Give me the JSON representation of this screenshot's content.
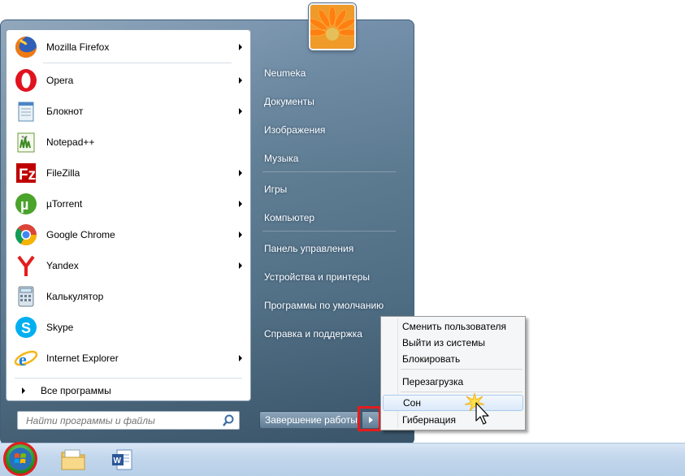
{
  "start_menu": {
    "programs": [
      {
        "label": "Mozilla Firefox",
        "icon": "firefox-icon",
        "has_submenu": true
      },
      {
        "label": "Opera",
        "icon": "opera-icon",
        "has_submenu": true
      },
      {
        "label": "Блокнот",
        "icon": "notepad-icon",
        "has_submenu": true
      },
      {
        "label": "Notepad++",
        "icon": "notepad-plus-plus-icon",
        "has_submenu": false
      },
      {
        "label": "FileZilla",
        "icon": "filezilla-icon",
        "has_submenu": true
      },
      {
        "label": "µTorrent",
        "icon": "utorrent-icon",
        "has_submenu": true
      },
      {
        "label": "Google Chrome",
        "icon": "chrome-icon",
        "has_submenu": true
      },
      {
        "label": "Yandex",
        "icon": "yandex-icon",
        "has_submenu": true
      },
      {
        "label": "Калькулятор",
        "icon": "calculator-icon",
        "has_submenu": false
      },
      {
        "label": "Skype",
        "icon": "skype-icon",
        "has_submenu": false
      },
      {
        "label": "Internet Explorer",
        "icon": "internet-explorer-icon",
        "has_submenu": true
      }
    ],
    "all_programs_label": "Все программы",
    "search_placeholder": "Найти программы и файлы",
    "right_links": [
      {
        "label": "Neumeka"
      },
      {
        "label": "Документы"
      },
      {
        "label": "Изображения"
      },
      {
        "label": "Музыка"
      },
      {
        "label": "Игры"
      },
      {
        "label": "Компьютер"
      },
      {
        "label": "Панель управления"
      },
      {
        "label": "Устройства и принтеры"
      },
      {
        "label": "Программы по умолчанию"
      },
      {
        "label": "Справка и поддержка"
      }
    ],
    "shutdown_label": "Завершение работы"
  },
  "power_menu": {
    "items": [
      {
        "label": "Сменить пользователя"
      },
      {
        "label": "Выйти из системы"
      },
      {
        "label": "Блокировать"
      },
      {
        "label": "Перезагрузка"
      },
      {
        "label": "Сон"
      },
      {
        "label": "Гибернация"
      }
    ],
    "hovered": "Сон"
  },
  "colors": {
    "highlight_red": "#e31d1d",
    "menu_glass": "#58788f"
  }
}
